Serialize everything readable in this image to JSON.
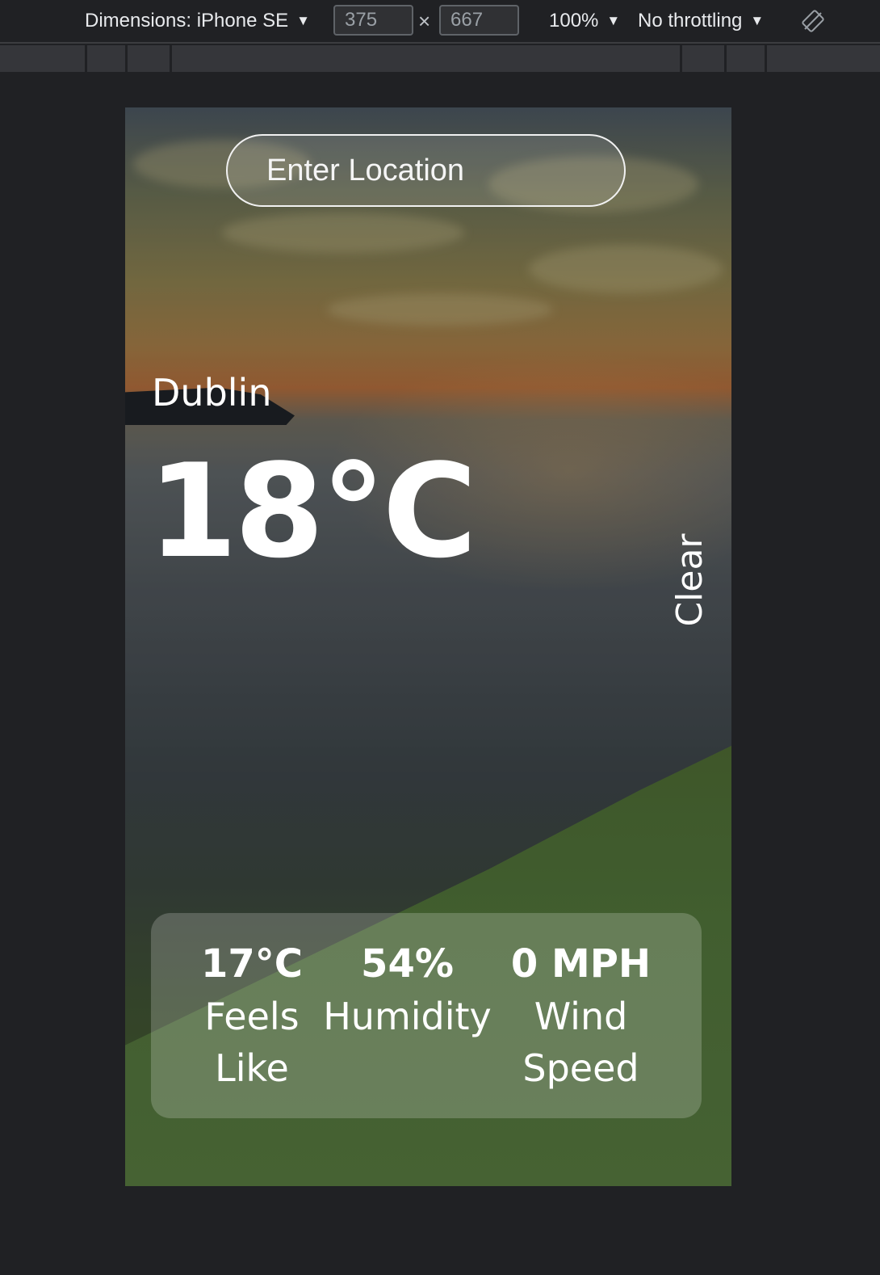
{
  "devtools": {
    "device_label": "Dimensions: iPhone SE",
    "width_value": "375",
    "times_symbol": "×",
    "height_value": "667",
    "zoom": "100%",
    "throttling": "No throttling",
    "caret": "▼"
  },
  "app": {
    "search": {
      "placeholder": "Enter Location",
      "value": ""
    },
    "city": "Dublin",
    "temperature": "18°C",
    "condition": "Clear",
    "stats": [
      {
        "value": "17°C",
        "label_line1": "Feels",
        "label_line2": "Like"
      },
      {
        "value": "54%",
        "label_line1": "Humidity",
        "label_line2": ""
      },
      {
        "value": "0 MPH",
        "label_line1": "Wind",
        "label_line2": "Speed"
      }
    ]
  }
}
